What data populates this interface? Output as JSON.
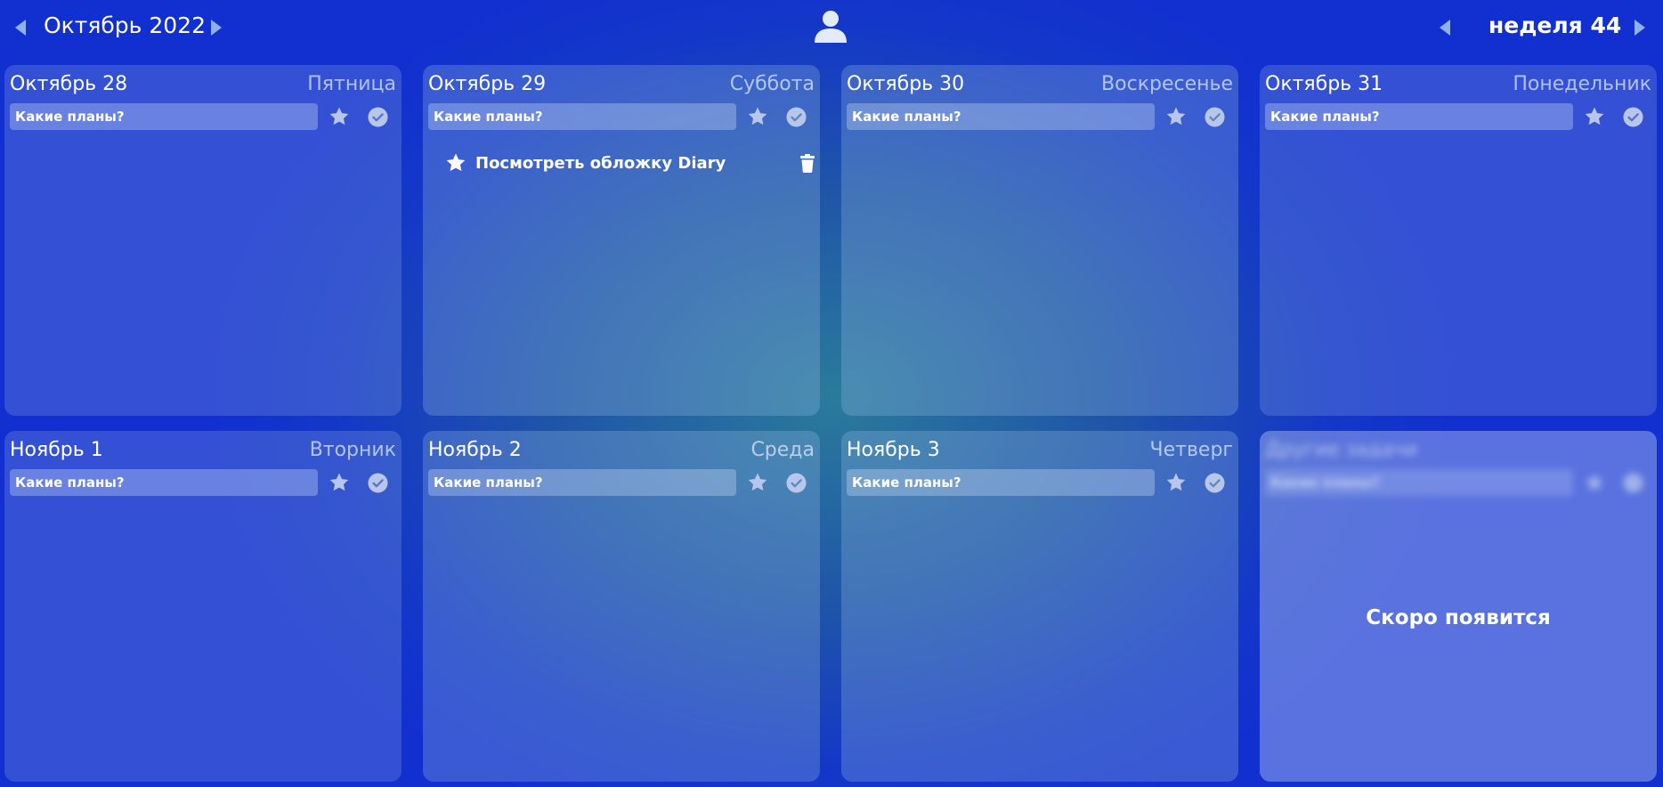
{
  "header": {
    "month_title": "Октябрь 2022",
    "week_title": "неделя 44",
    "user_icon": "user-icon",
    "prev_month_icon": "caret-left-icon",
    "next_month_icon": "caret-right-icon"
  },
  "plan_placeholder": "Какие планы?",
  "days": [
    {
      "date": "Октябрь 28",
      "weekday": "Пятница",
      "tasks": []
    },
    {
      "date": "Октябрь 29",
      "weekday": "Суббота",
      "tasks": [
        {
          "text": "Посмотреть обложку Diary",
          "starred": true
        }
      ]
    },
    {
      "date": "Октябрь 30",
      "weekday": "Воскресенье",
      "tasks": []
    },
    {
      "date": "Октябрь 31",
      "weekday": "Понедельник",
      "tasks": []
    },
    {
      "date": "Ноябрь 1",
      "weekday": "Вторник",
      "tasks": []
    },
    {
      "date": "Ноябрь 2",
      "weekday": "Среда",
      "tasks": []
    },
    {
      "date": "Ноябрь 3",
      "weekday": "Четверг",
      "tasks": []
    }
  ],
  "other_tasks": {
    "title": "Другие задачи",
    "placeholder": "Какие планы?",
    "overlay_text": "Скоро появится"
  },
  "colors": {
    "background_edge": "#1230d0",
    "background_center": "#2a7b9c",
    "icon_muted": "#b7c6ea"
  }
}
